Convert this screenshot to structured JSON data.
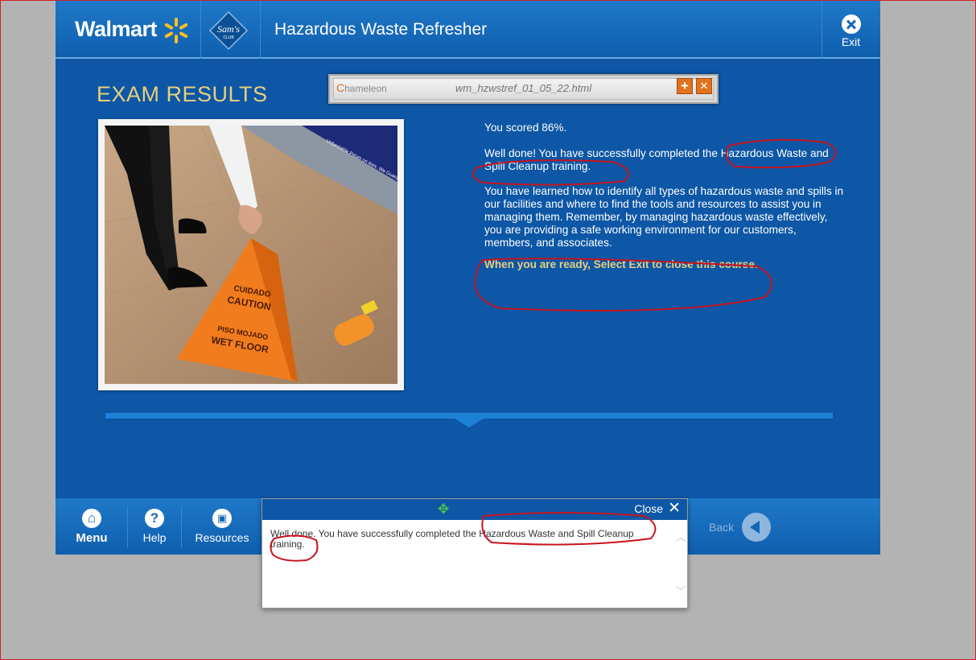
{
  "header": {
    "walmart_logo": "Walmart",
    "sams_logo_line1": "Sam's",
    "sams_logo_line2": "CLUB",
    "course_title": "Hazardous Waste Refresher",
    "exit_label": "Exit"
  },
  "main": {
    "heading": "EXAM RESULTS",
    "score": "You scored 86%.",
    "well_done": "Well done!  You have successfully completed the Hazardous Waste and Spill Cleanup training.",
    "learned": "You have learned how to identify all types of hazardous waste and spills in our facilities and where to find the tools and resources to assist you in managing them.  Remember, by managing hazardous waste effectively, you are providing a safe working environment for our customers, members, and associates.",
    "ready": "When you are ready, Select Exit to close this course.",
    "photo": {
      "sign_line1": "CUIDADO",
      "sign_line2": "CAUTION",
      "sign_line3": "PISO MOJADO",
      "sign_line4": "WET FLOOR",
      "shelf_text": "Unbeatable Prices on tires. We Guarantee"
    }
  },
  "footer": {
    "menu_label": "Menu",
    "help_label": "Help",
    "resources_label": "Resources",
    "back_label": "Back"
  },
  "chameleon": {
    "logo": "hameleon",
    "logo_prefix": "C",
    "filename": "wm_hzwstref_01_05_22.html",
    "plus": "+",
    "close": "✕"
  },
  "popup": {
    "close_label": "Close",
    "text": "Well done.  You have successfully completed the Hazardous Waste and Spill Cleanup training."
  },
  "colors": {
    "brand_blue": "#0d57a6",
    "accent_gold": "#e8cf7c",
    "annotation_red": "#d0202a"
  }
}
